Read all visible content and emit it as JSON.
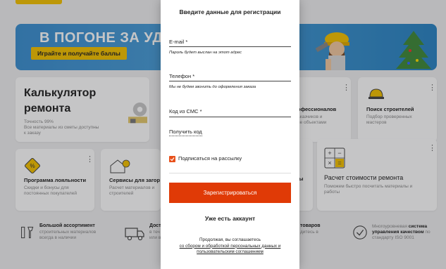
{
  "banner": {
    "title": "В ПОГОНЕ ЗА УДА",
    "button": "Играйте и получайте баллы"
  },
  "cards": {
    "calculator": {
      "title_line1": "Калькулятор",
      "title_line2": "ремонта",
      "sub_line1": "Точность 99%",
      "sub_line2": "Все материалы из сметы доступны",
      "sub_line3": "к заказу"
    },
    "professionals": {
      "title": "офессионалов",
      "sub_line1": "аказчиков и",
      "sub_line2": "ие объектами"
    },
    "builders": {
      "title": "Поиск строителей",
      "sub_line1": "Подбор проверенных",
      "sub_line2": "мастеров"
    },
    "loyalty": {
      "title": "Программа лояльности",
      "sub_line1": "Скидки и бонусы для",
      "sub_line2": "постоянных покупателей"
    },
    "services": {
      "title": "Сервисы для загор",
      "sub_line1": "Расчет материалов и",
      "sub_line2": "строителей"
    },
    "partial": {
      "title": "ы"
    },
    "estimate": {
      "title": "Расчет стоимости ремонта",
      "sub_line1": "Поможем быстро посчитать материалы и",
      "sub_line2": "работы"
    }
  },
  "features": {
    "assortment": {
      "title": "Большой ассортимент",
      "sub_line1": "строительных материалов",
      "sub_line2": "всегда в наличии"
    },
    "delivery": {
      "title": "Дост",
      "sub_line1": "в теч",
      "sub_line2": "или в"
    },
    "goods": {
      "title": "товаров",
      "sub_line1": "дитесь в"
    },
    "quality": {
      "pre": "Многоуровневая ",
      "bold1": "система",
      "bold2": "управления качеством",
      "post": " по",
      "line3": "стандарту ISO 9001"
    }
  },
  "modal": {
    "title": "Введите данные для регистрации",
    "email_label": "E-mail *",
    "email_value": "",
    "email_hint": "Пароль будет выслан на этот адрес",
    "phone_label": "Телефон *",
    "phone_value": "",
    "phone_hint": "Мы не будем звонить до оформления заказа",
    "code_label": "Код из СМС *",
    "code_value": "",
    "get_code": "Получить код",
    "subscribe_label": "Подписаться на рассылку",
    "subscribe_checked": true,
    "submit_label": "Зарегистрироваться",
    "login_label": "Уже есть аккаунт",
    "consent_line1": "Продолжая, вы соглашаетесь",
    "consent_link1": "со сбором и обработкой персональных данных и",
    "consent_link2": "пользовательским соглашением"
  },
  "colors": {
    "accent": "#e03a06",
    "checkbox": "#e8501a",
    "banner_blue": "#3b8fd1",
    "yellow": "#f4c200"
  }
}
